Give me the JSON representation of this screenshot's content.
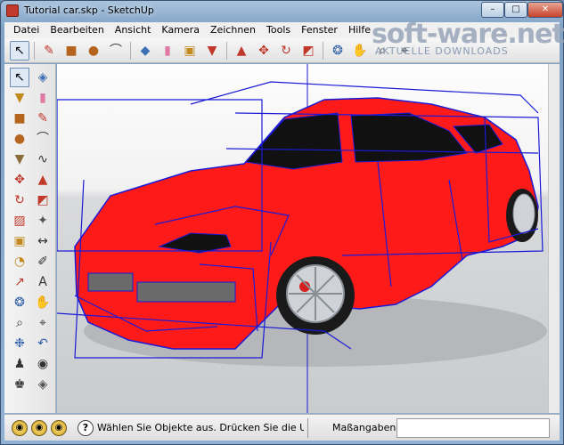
{
  "window": {
    "title": "Tutorial car.skp - SketchUp",
    "minimize_glyph": "–",
    "maximize_glyph": "□",
    "close_glyph": "✕"
  },
  "menu": [
    "Datei",
    "Bearbeiten",
    "Ansicht",
    "Kamera",
    "Zeichnen",
    "Tools",
    "Fenster",
    "Hilfe"
  ],
  "toolbar_top": [
    {
      "icon": "select-arrow-icon",
      "glyph": "↖",
      "color": "#000000",
      "active": true
    },
    {
      "icon": "pencil-line-icon",
      "glyph": "✎",
      "color": "#c0392b"
    },
    {
      "icon": "rectangle-icon",
      "glyph": "■",
      "color": "#b5651d"
    },
    {
      "icon": "circle-icon",
      "glyph": "●",
      "color": "#b5651d"
    },
    {
      "icon": "arc-icon",
      "glyph": "⌒",
      "color": "#333333"
    },
    {
      "icon": "make-component-icon",
      "glyph": "◆",
      "color": "#3d6fb6"
    },
    {
      "icon": "eraser-icon",
      "glyph": "▮",
      "color": "#e07aa5"
    },
    {
      "icon": "tape-measure-icon",
      "glyph": "▣",
      "color": "#c28a1e"
    },
    {
      "icon": "paint-bucket-icon",
      "glyph": "▼",
      "color": "#c0392b"
    },
    {
      "icon": "push-pull-icon",
      "glyph": "▲",
      "color": "#c0392b"
    },
    {
      "icon": "move-icon",
      "glyph": "✥",
      "color": "#c0392b"
    },
    {
      "icon": "rotate-icon",
      "glyph": "↻",
      "color": "#c0392b"
    },
    {
      "icon": "follow-me-icon",
      "glyph": "◩",
      "color": "#c0392b"
    },
    {
      "icon": "orbit-icon",
      "glyph": "❂",
      "color": "#2e5fa8"
    },
    {
      "icon": "pan-hand-icon",
      "glyph": "✋",
      "color": "#555555"
    },
    {
      "icon": "zoom-icon",
      "glyph": "⌕",
      "color": "#333333"
    },
    {
      "icon": "zoom-window-icon",
      "glyph": "⌖",
      "color": "#333333"
    }
  ],
  "toolbar_left": [
    {
      "icon": "select-arrow-icon",
      "glyph": "↖",
      "color": "#000000",
      "active": true
    },
    {
      "icon": "make-component-icon",
      "glyph": "◈",
      "color": "#3d6fb6"
    },
    {
      "icon": "paint-bucket-icon",
      "glyph": "▼",
      "color": "#c28a1e"
    },
    {
      "icon": "eraser-icon",
      "glyph": "▮",
      "color": "#e07aa5"
    },
    {
      "icon": "rectangle-icon",
      "glyph": "■",
      "color": "#b5651d"
    },
    {
      "icon": "pencil-line-icon",
      "glyph": "✎",
      "color": "#c0392b"
    },
    {
      "icon": "circle-icon",
      "glyph": "●",
      "color": "#b5651d"
    },
    {
      "icon": "arc-icon",
      "glyph": "⌒",
      "color": "#333333"
    },
    {
      "icon": "polygon-icon",
      "glyph": "▼",
      "color": "#8a6d3b"
    },
    {
      "icon": "freehand-icon",
      "glyph": "∿",
      "color": "#333333"
    },
    {
      "icon": "move-icon",
      "glyph": "✥",
      "color": "#c0392b"
    },
    {
      "icon": "push-pull-icon",
      "glyph": "▲",
      "color": "#c0392b"
    },
    {
      "icon": "rotate-icon",
      "glyph": "↻",
      "color": "#c0392b"
    },
    {
      "icon": "follow-me-icon",
      "glyph": "◩",
      "color": "#c0392b"
    },
    {
      "icon": "scale-icon",
      "glyph": "▨",
      "color": "#c0392b"
    },
    {
      "icon": "offset-icon",
      "glyph": "✦",
      "color": "#555555"
    },
    {
      "icon": "tape-measure-icon",
      "glyph": "▣",
      "color": "#c28a1e"
    },
    {
      "icon": "dimension-icon",
      "glyph": "↔",
      "color": "#333333"
    },
    {
      "icon": "protractor-icon",
      "glyph": "◔",
      "color": "#c28a1e"
    },
    {
      "icon": "text-icon",
      "glyph": "✐",
      "color": "#333333"
    },
    {
      "icon": "axes-icon",
      "glyph": "↗",
      "color": "#c0392b"
    },
    {
      "icon": "3d-text-icon",
      "glyph": "A",
      "color": "#333333"
    },
    {
      "icon": "orbit-icon",
      "glyph": "❂",
      "color": "#2e5fa8"
    },
    {
      "icon": "pan-hand-icon",
      "glyph": "✋",
      "color": "#555555"
    },
    {
      "icon": "zoom-icon",
      "glyph": "⌕",
      "color": "#333333"
    },
    {
      "icon": "zoom-window-icon",
      "glyph": "⌖",
      "color": "#333333"
    },
    {
      "icon": "zoom-extents-icon",
      "glyph": "❉",
      "color": "#2e5fa8"
    },
    {
      "icon": "previous-view-icon",
      "glyph": "↶",
      "color": "#2e5fa8"
    },
    {
      "icon": "position-camera-icon",
      "glyph": "♟",
      "color": "#333333"
    },
    {
      "icon": "look-around-icon",
      "glyph": "◉",
      "color": "#333333"
    },
    {
      "icon": "walk-icon",
      "glyph": "♚",
      "color": "#333333"
    },
    {
      "icon": "section-plane-icon",
      "glyph": "◈",
      "color": "#555555"
    }
  ],
  "status": {
    "geo_icons": [
      "◉",
      "◉",
      "◉"
    ],
    "help_glyph": "?",
    "message": "Wählen Sie Objekte aus. Drücken Sie die Umschalt",
    "measure_label": "Maßangaben",
    "measure_value": ""
  },
  "watermark": {
    "title": "soft-ware.net",
    "subtitle": "AKTUELLE DOWNLOADS"
  },
  "colors": {
    "car_body": "#ff1a1a",
    "wireframe": "#1a1ad6",
    "glass": "#111111"
  }
}
